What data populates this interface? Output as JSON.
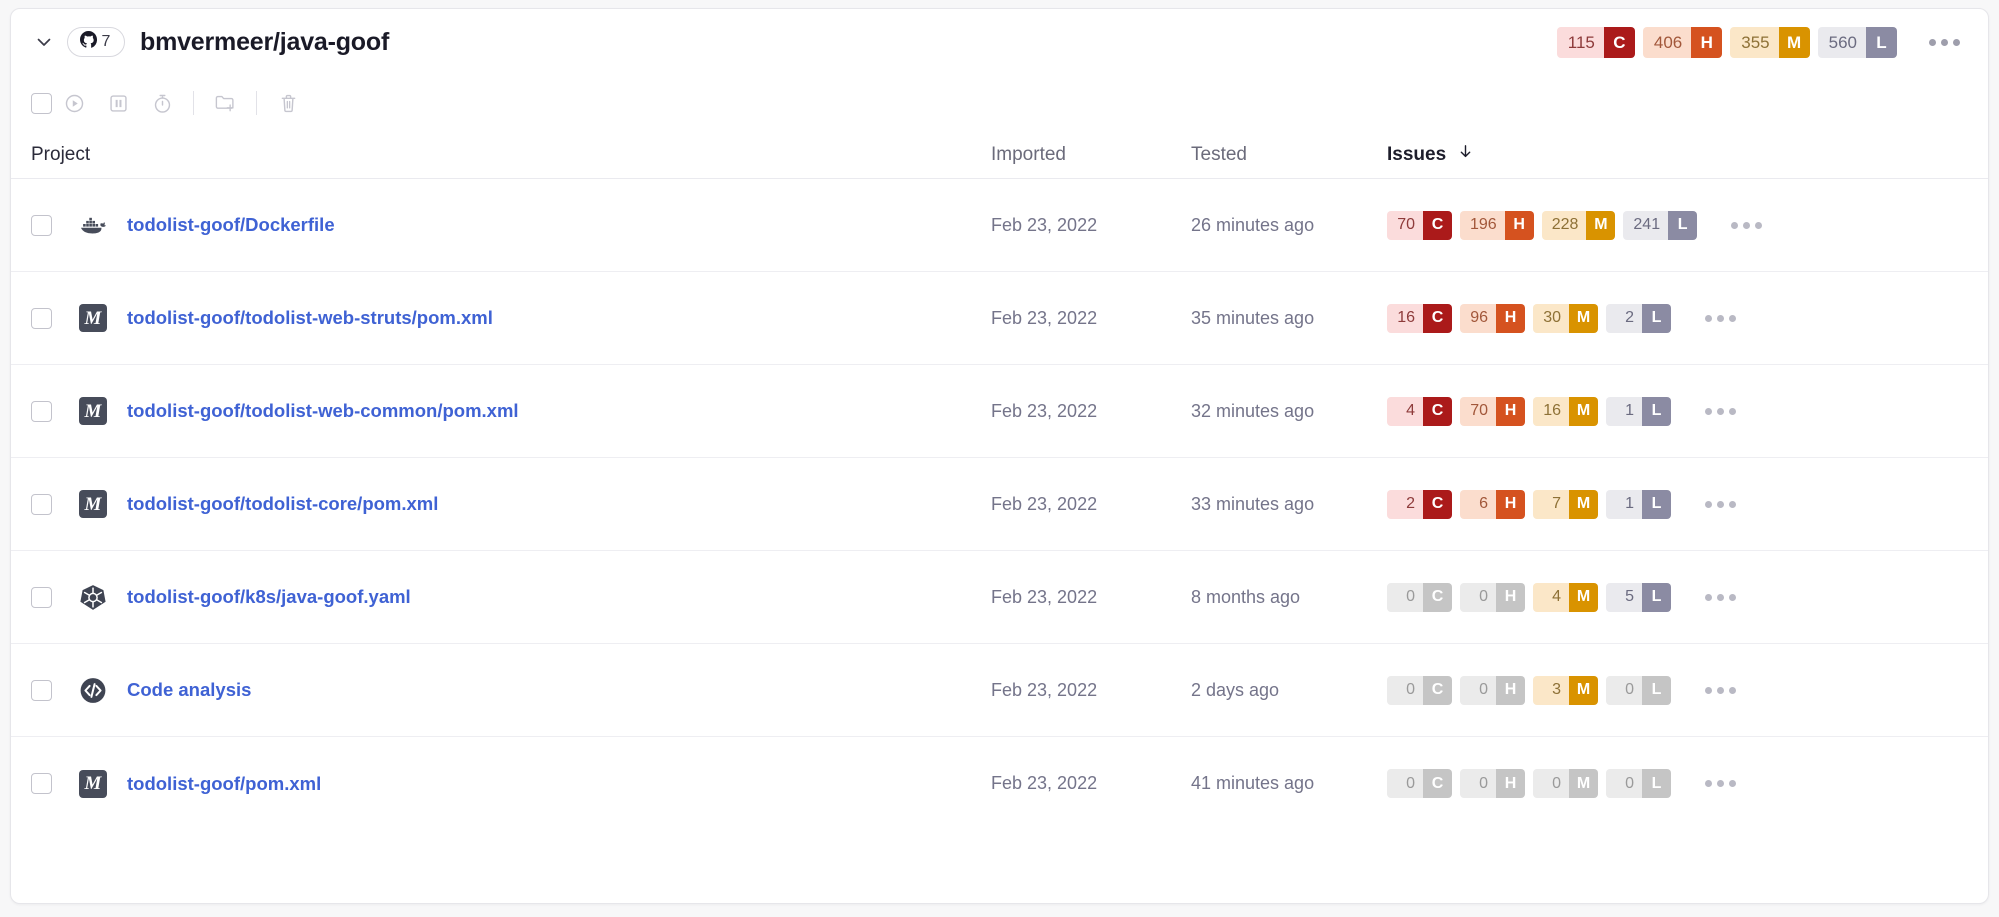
{
  "header": {
    "collapse_icon": "chevron-down-icon",
    "source_icon": "github-icon",
    "source_count": "7",
    "title": "bmvermeer/java-goof",
    "severities": [
      {
        "count": "115",
        "letter": "C",
        "name": "critical"
      },
      {
        "count": "406",
        "letter": "H",
        "name": "high"
      },
      {
        "count": "355",
        "letter": "M",
        "name": "medium"
      },
      {
        "count": "560",
        "letter": "L",
        "name": "low"
      }
    ],
    "more_label": "more-options"
  },
  "toolbar": {
    "select_all": "select-all-checkbox",
    "actions": [
      {
        "name": "retest-button",
        "icon": "play-circle-icon"
      },
      {
        "name": "snooze-button",
        "icon": "pause-square-icon"
      },
      {
        "name": "schedule-button",
        "icon": "stopwatch-icon"
      },
      {
        "name": "move-to-project-button",
        "icon": "folder-plus-icon"
      },
      {
        "name": "delete-button",
        "icon": "trash-icon"
      }
    ]
  },
  "table": {
    "columns": {
      "project": "Project",
      "imported": "Imported",
      "tested": "Tested",
      "issues": "Issues"
    },
    "sort": {
      "column": "issues",
      "direction": "desc",
      "icon": "arrow-down-icon"
    },
    "rows": [
      {
        "icon": "docker-icon",
        "name": "todolist-goof/Dockerfile",
        "imported": "Feb 23, 2022",
        "tested": "26 minutes ago",
        "severities": [
          {
            "count": "70",
            "letter": "C",
            "zero": false
          },
          {
            "count": "196",
            "letter": "H",
            "zero": false
          },
          {
            "count": "228",
            "letter": "M",
            "zero": false
          },
          {
            "count": "241",
            "letter": "L",
            "zero": false
          }
        ]
      },
      {
        "icon": "maven-icon",
        "name": "todolist-goof/todolist-web-struts/pom.xml",
        "imported": "Feb 23, 2022",
        "tested": "35 minutes ago",
        "severities": [
          {
            "count": "16",
            "letter": "C",
            "zero": false
          },
          {
            "count": "96",
            "letter": "H",
            "zero": false
          },
          {
            "count": "30",
            "letter": "M",
            "zero": false
          },
          {
            "count": "2",
            "letter": "L",
            "zero": false
          }
        ]
      },
      {
        "icon": "maven-icon",
        "name": "todolist-goof/todolist-web-common/pom.xml",
        "imported": "Feb 23, 2022",
        "tested": "32 minutes ago",
        "severities": [
          {
            "count": "4",
            "letter": "C",
            "zero": false
          },
          {
            "count": "70",
            "letter": "H",
            "zero": false
          },
          {
            "count": "16",
            "letter": "M",
            "zero": false
          },
          {
            "count": "1",
            "letter": "L",
            "zero": false
          }
        ]
      },
      {
        "icon": "maven-icon",
        "name": "todolist-goof/todolist-core/pom.xml",
        "imported": "Feb 23, 2022",
        "tested": "33 minutes ago",
        "severities": [
          {
            "count": "2",
            "letter": "C",
            "zero": false
          },
          {
            "count": "6",
            "letter": "H",
            "zero": false
          },
          {
            "count": "7",
            "letter": "M",
            "zero": false
          },
          {
            "count": "1",
            "letter": "L",
            "zero": false
          }
        ]
      },
      {
        "icon": "kubernetes-icon",
        "name": "todolist-goof/k8s/java-goof.yaml",
        "imported": "Feb 23, 2022",
        "tested": "8 months ago",
        "severities": [
          {
            "count": "0",
            "letter": "C",
            "zero": true
          },
          {
            "count": "0",
            "letter": "H",
            "zero": true
          },
          {
            "count": "4",
            "letter": "M",
            "zero": false
          },
          {
            "count": "5",
            "letter": "L",
            "zero": false
          }
        ]
      },
      {
        "icon": "code-analysis-icon",
        "name": "Code analysis",
        "imported": "Feb 23, 2022",
        "tested": "2 days ago",
        "severities": [
          {
            "count": "0",
            "letter": "C",
            "zero": true
          },
          {
            "count": "0",
            "letter": "H",
            "zero": true
          },
          {
            "count": "3",
            "letter": "M",
            "zero": false
          },
          {
            "count": "0",
            "letter": "L",
            "zero": true
          }
        ]
      },
      {
        "icon": "maven-icon",
        "name": "todolist-goof/pom.xml",
        "imported": "Feb 23, 2022",
        "tested": "41 minutes ago",
        "severities": [
          {
            "count": "0",
            "letter": "C",
            "zero": true
          },
          {
            "count": "0",
            "letter": "H",
            "zero": true
          },
          {
            "count": "0",
            "letter": "M",
            "zero": true
          },
          {
            "count": "0",
            "letter": "L",
            "zero": true
          }
        ]
      }
    ]
  },
  "colors": {
    "critical_chip": "#ab1a1a",
    "critical_bg": "#fbdcdc",
    "critical_text": "#8e3b3b",
    "high_chip": "#d5521f",
    "high_bg": "#fbddcd",
    "high_text": "#a2573a",
    "medium_chip": "#d99300",
    "medium_bg": "#fbe7c8",
    "medium_text": "#8e7136",
    "low_chip": "#8b8ba3",
    "low_bg": "#eaeaee",
    "low_text": "#6b6b80",
    "zero_chip": "#c5c5c5",
    "zero_bg": "#ebebeb",
    "zero_text": "#9a9a9a",
    "link": "#3f62d4",
    "icon_dark": "#474c5a"
  }
}
